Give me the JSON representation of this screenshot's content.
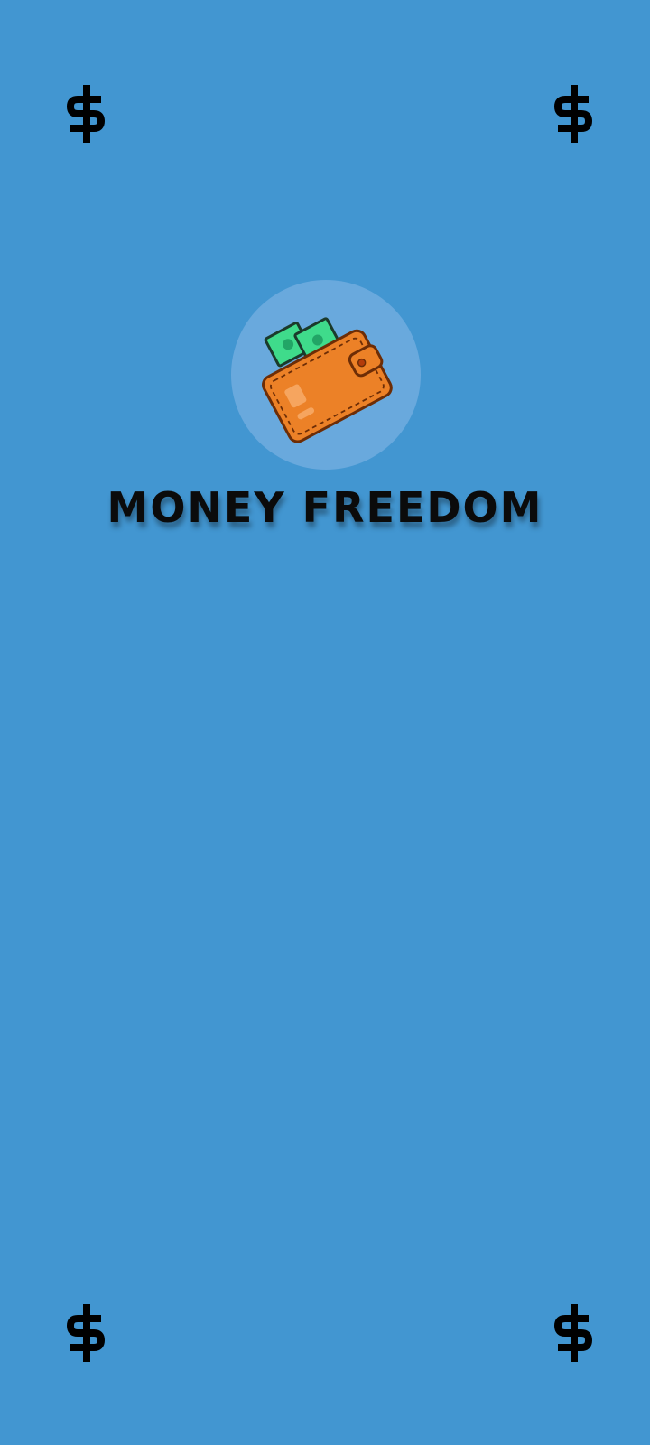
{
  "app": {
    "title": "MONEY FREEDOM"
  },
  "decorations": {
    "corner_icon": "dollar-sign-icon"
  },
  "logo": {
    "icon": "wallet-with-cash-icon"
  },
  "colors": {
    "background": "#4296d1",
    "logo_circle": "#69a9dd",
    "wallet": "#ec8127",
    "cash": "#3fdb8b",
    "title_text": "#0b0b0b"
  }
}
